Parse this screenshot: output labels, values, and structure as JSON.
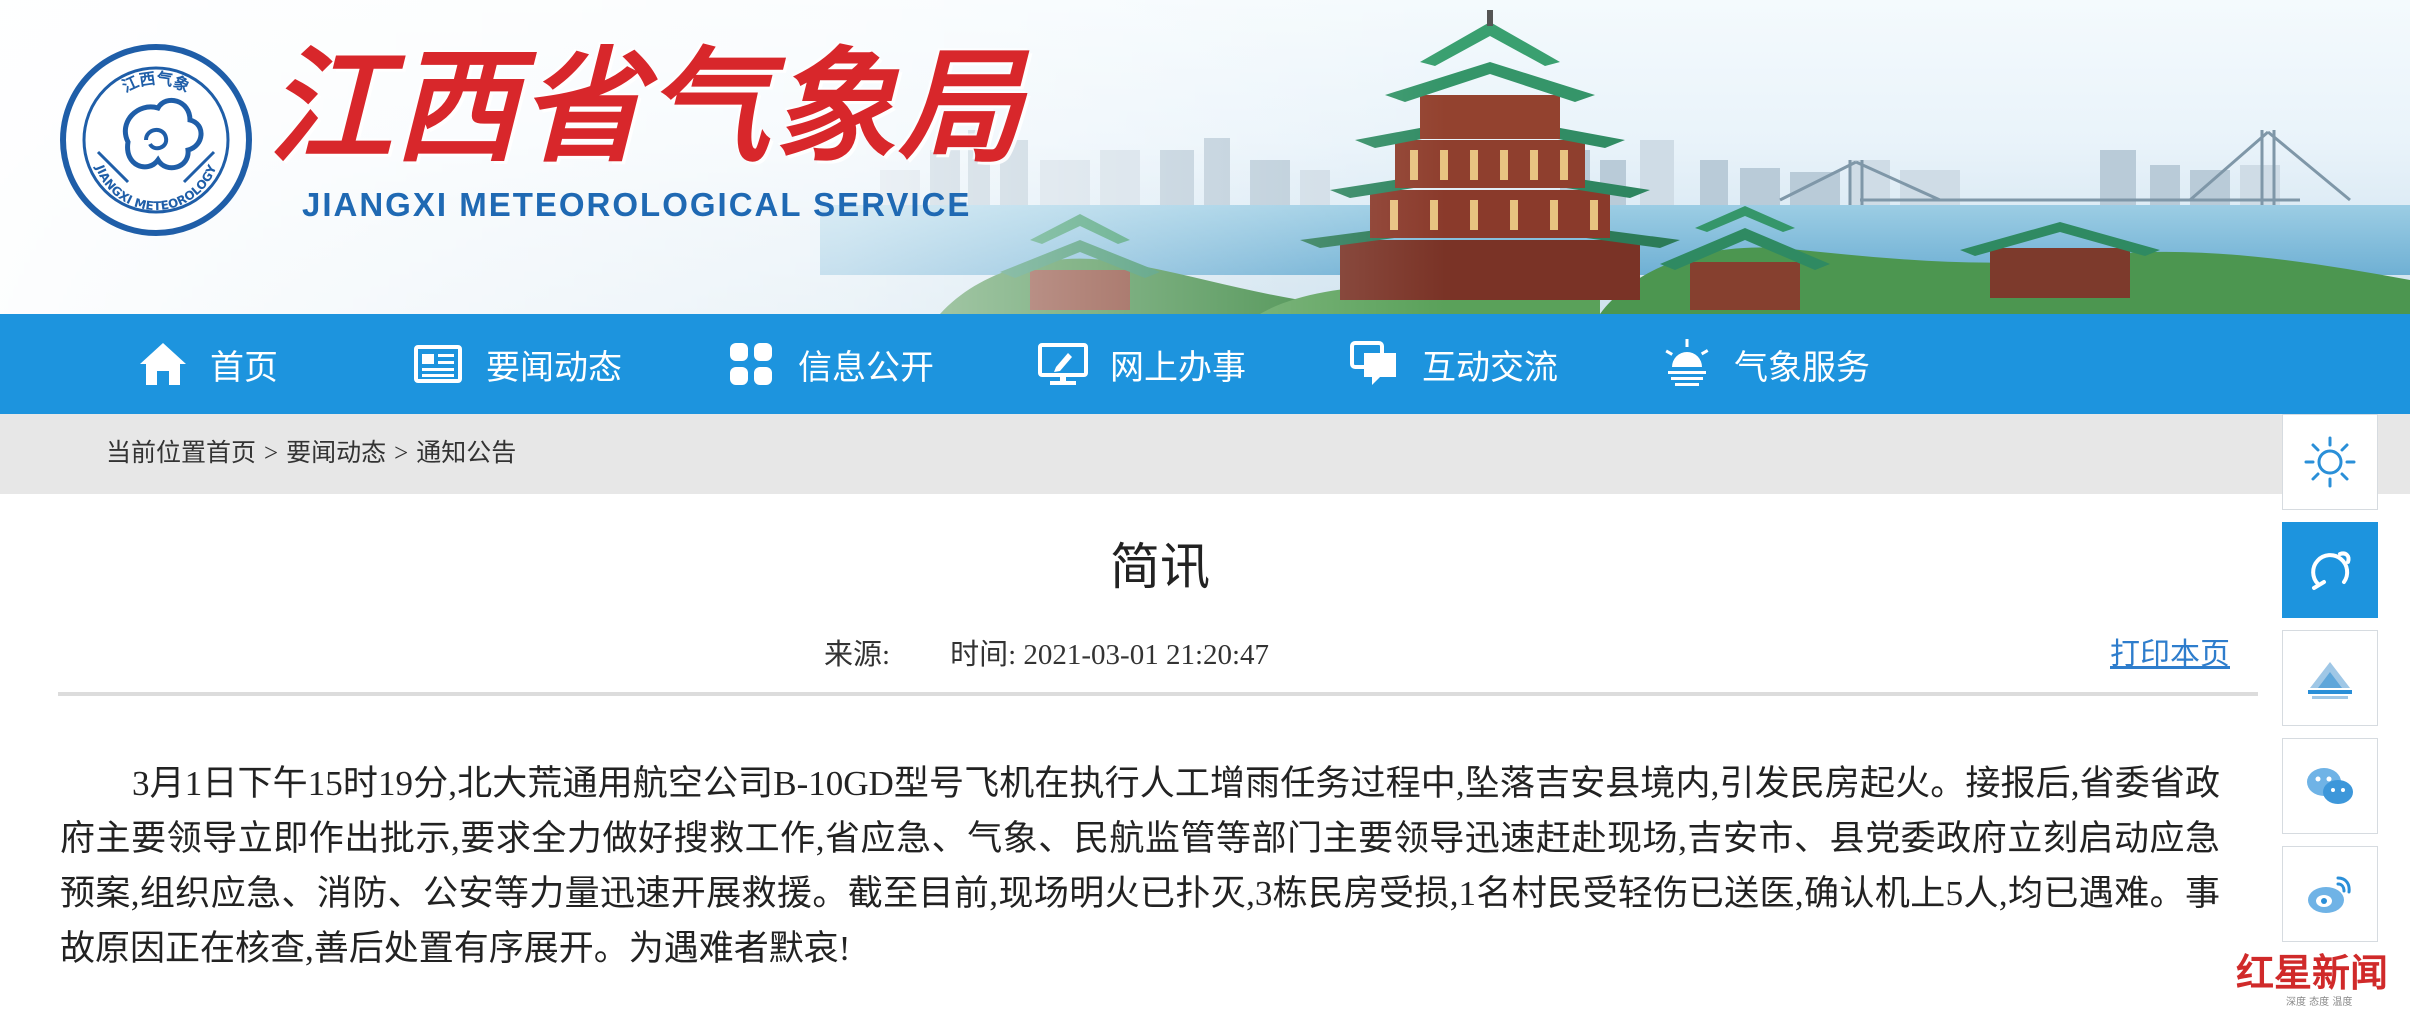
{
  "header": {
    "title_cn": "江西省气象局",
    "title_en": "JIANGXI METEOROLOGICAL SERVICE",
    "logo": {
      "top_text": "江西气象",
      "bottom_text": "JIANGXI METEOROLOGY"
    }
  },
  "nav": {
    "items": [
      {
        "label": "首页",
        "icon": "home-icon"
      },
      {
        "label": "要闻动态",
        "icon": "news-icon"
      },
      {
        "label": "信息公开",
        "icon": "grid-icon"
      },
      {
        "label": "网上办事",
        "icon": "monitor-icon"
      },
      {
        "label": "互动交流",
        "icon": "chat-icon"
      },
      {
        "label": "气象服务",
        "icon": "weather-icon"
      }
    ]
  },
  "breadcrumb": {
    "prefix": "当前位置",
    "items": [
      "首页",
      "要闻动态",
      "通知公告"
    ],
    "separator": ">"
  },
  "sidebar": {
    "buttons": [
      "sun-icon",
      "mini-program-icon",
      "app-icon",
      "wechat-icon",
      "weibo-icon"
    ]
  },
  "article": {
    "title": "简讯",
    "source_label": "来源:",
    "time_label": "时间:",
    "time_value": "2021-03-01 21:20:47",
    "print_label": "打印本页",
    "body": "3月1日下午15时19分,北大荒通用航空公司B-10GD型号飞机在执行人工增雨任务过程中,坠落吉安县境内,引发民房起火。接报后,省委省政府主要领导立即作出批示,要求全力做好搜救工作,省应急、气象、民航监管等部门主要领导迅速赶赴现场,吉安市、县党委政府立刻启动应急预案,组织应急、消防、公安等力量迅速开展救援。截至目前,现场明火已扑灭,3栋民房受损,1名村民受轻伤已送医,确认机上5人,均已遇难。事故原因正在核查,善后处置有序展开。为遇难者默哀!"
  },
  "watermark": {
    "text": "红星新闻",
    "sub": "深度 态度 温度"
  },
  "colors": {
    "nav_bg": "#1d94de",
    "title_red": "#d8272b",
    "title_blue": "#1f69b3",
    "link": "#2e7dcc"
  }
}
